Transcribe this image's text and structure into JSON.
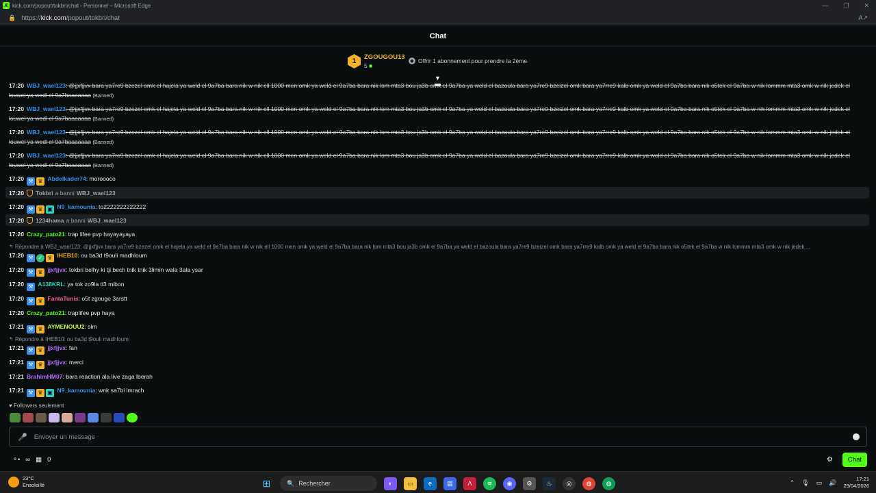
{
  "browser": {
    "title": "kick.com/popout/tokbri/chat - Personnel – Microsoft Edge",
    "url_prefix": "https://",
    "url_domain": "kick.com",
    "url_path": "/popout/tokbri/chat"
  },
  "chat": {
    "title": "Chat",
    "pinned": {
      "rank": "1",
      "username": "ZGOUGOU13",
      "count": "5",
      "gift_text": "Offrir 1 abonnement pour prendre la 2ème"
    }
  },
  "messages": {
    "banned_text": "@jjxfjjvx bara ya7re9 bzezel omk el hajela ya weld el 9a7ba bara nik w nik ell 1000 men omk ya weld el 9a7ba bara nik lom mta3 bou ja3b omk el 9a7ba ya weld el bazoula bara ya7re9 bzeizel omk bara ya7rre9 kalb omk ya weld el 9a7ba bara nik o5tek el 9a7ba w nik lommm mta3 omk w nik jedek el louwel ya wedl el 9a7baaaaaaa",
    "banned_tag": "(Banned)",
    "banned_user": "WBJ_wael123",
    "banned_time": "17:20",
    "m1": {
      "time": "17:20",
      "user": "Abdelkader74",
      "text": ": moroooco"
    },
    "s1": {
      "time": "17:20",
      "who": "Tokbri",
      "action": "a banni",
      "target": "WBJ_wael123"
    },
    "m2": {
      "time": "17:20",
      "user": "N9_kamounia",
      "text": ": to2222222222222"
    },
    "s2": {
      "time": "17:20",
      "who": "1234hama",
      "action": "a banni",
      "target": "WBJ_wael123"
    },
    "m3": {
      "time": "17:20",
      "user": "Crazy_pato21",
      "text": ": trap lifee pvp hayayayaya"
    },
    "r1": "Répondre à WBJ_wael123: @jjxfjjvx bara ya7re9 bzezel omk el hajela ya weld el 9a7ba bara nik w nik ell 1000 men omk ya weld el 9a7ba bara nik lom mta3 bou ja3b omk el 9a7ba ya weld el bazoula bara ya7re9 bzeizel omk bara ya7rre9 kalb omk ya weld el 9a7ba bara nik o5tek el 9a7ba w nik lommm mta3 omk w nik jedek ...",
    "m4": {
      "time": "17:20",
      "user": "IHEB10",
      "text": ": ou ba3d t9ouli madhloum"
    },
    "m5": {
      "time": "17:20",
      "user": "jjxfjjvx",
      "text": ": tokbri belhy ki tji bech tnik tnik 3limin wala 3ala ysar"
    },
    "m6": {
      "time": "17:20",
      "user": "A138KRL",
      "text": ": ya tok zo9la tl3 mibon"
    },
    "m7": {
      "time": "17:20",
      "user": "FantaTunis",
      "text": ": o5t zgougo 3arstt"
    },
    "m8": {
      "time": "17:20",
      "user": "Crazy_pato21",
      "text": ": traplifee pvp haya"
    },
    "m9": {
      "time": "17:21",
      "user": "AYMENOUU2",
      "text": ": slm"
    },
    "r2": "Répondre à IHEB10: ou ba3d t9ouli madhloum",
    "m10": {
      "time": "17:21",
      "user": "jjxfjjvx",
      "text": ": fan"
    },
    "m11": {
      "time": "17:21",
      "user": "jjxfjjvx",
      "text": ": merci"
    },
    "m12": {
      "time": "17:21",
      "user": "BrahimHM07",
      "text": ": bara reaction ala live zaga lberah"
    },
    "m13": {
      "time": "17:21",
      "user": "N9_kamounia",
      "text": ": wnk sa7bi lmrach"
    }
  },
  "footer": {
    "followers_only": "Followers seulement",
    "input_placeholder": "Envoyer un message",
    "viewers": "∞",
    "points": "0",
    "send_label": "Chat"
  },
  "taskbar": {
    "temp": "23°C",
    "weather": "Ensoleillé",
    "search": "Rechercher",
    "time": "17:21",
    "date": "29/04/2026"
  },
  "colors": {
    "kick_green": "#53fc18",
    "user_blue": "#3a8ee6",
    "user_green": "#53fc18",
    "user_orange": "#f3b32a",
    "user_purple": "#b56bff",
    "user_pink": "#ff5a8a",
    "user_teal": "#2fd4b8"
  }
}
